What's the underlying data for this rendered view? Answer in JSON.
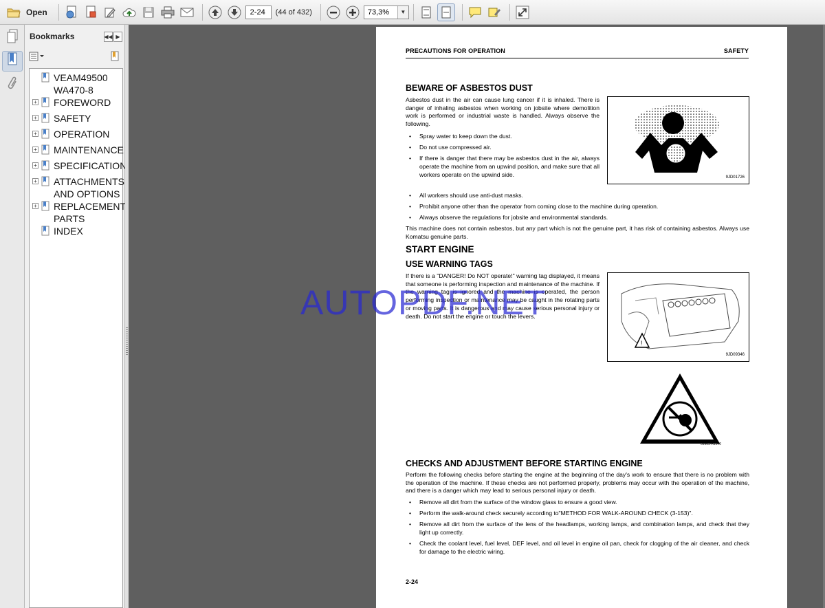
{
  "toolbar": {
    "open_label": "Open",
    "page_input": "2-24",
    "page_count": "(44 of 432)",
    "zoom_value": "73,3%"
  },
  "bookmarks": {
    "title": "Bookmarks",
    "items": [
      {
        "label": "VEAM49500 WA470-8",
        "expandable": false
      },
      {
        "label": "FOREWORD",
        "expandable": true
      },
      {
        "label": "SAFETY",
        "expandable": true
      },
      {
        "label": "OPERATION",
        "expandable": true
      },
      {
        "label": "MAINTENANCE",
        "expandable": true
      },
      {
        "label": "SPECIFICATIONS",
        "expandable": true
      },
      {
        "label": "ATTACHMENTS AND OPTIONS",
        "expandable": true
      },
      {
        "label": "REPLACEMENT PARTS",
        "expandable": true
      },
      {
        "label": "INDEX",
        "expandable": false
      }
    ]
  },
  "page": {
    "header_left": "PRECAUTIONS FOR OPERATION",
    "header_right": "SAFETY",
    "asbestos": {
      "title": "BEWARE OF ASBESTOS DUST",
      "intro": "Asbestos dust in the air can cause lung cancer if it is inhaled. There is danger of inhaling asbestos when working on jobsite where demolition work is performed or industrial waste is handled. Always observe the following.",
      "bullets": [
        "Spray water to keep down the dust.",
        "Do not use compressed air.",
        "If there is danger that there may be asbestos dust in the air, always operate the machine from an upwind position, and make sure that all workers operate on the upwind side."
      ],
      "bullets_wide": [
        "All workers should use anti-dust masks.",
        "Prohibit anyone other than the operator from coming close to the machine during operation.",
        "Always observe the regulations for jobsite and environmental standards."
      ],
      "closing": "This machine does not contain asbestos, but any part which is not the genuine part, it has risk of containing asbestos. Always use Komatsu genuine parts.",
      "fig_code": "9JD01726"
    },
    "start_engine": {
      "title": "START ENGINE",
      "subtitle": "USE WARNING TAGS",
      "text": "If there is a \"DANGER! Do NOT operate!\" warning tag displayed, it means that someone is performing inspection and maintenance of the machine. If the warning tag is ignored and the machine is operated, the person performing inspection or maintenance may be caught in the rotating parts or moving parts. It is dangerous and may cause serious personal injury or death. Do not start the engine or touch the levers.",
      "fig_code": "9JD09346",
      "sign_code": "09963-A1640"
    },
    "checks": {
      "title": "CHECKS AND ADJUSTMENT BEFORE STARTING ENGINE",
      "intro": "Perform the following checks before starting the engine at the beginning of the day's work to ensure that there is no problem with the operation of the machine. If these checks are not performed properly, problems may occur with the operation of the machine, and there is a danger which may lead to serious personal injury or death.",
      "bullets": [
        "Remove all dirt from the surface of the window glass to ensure a good view.",
        "Perform the walk-around check securely according to\"METHOD FOR WALK-AROUND CHECK (3-153)\".",
        "Remove all dirt from the surface of the lens of the headlamps, working lamps, and combination lamps, and check that they light up correctly.",
        "Check the coolant level, fuel level, DEF level, and oil level in engine oil pan, check for clogging of the air cleaner, and check for damage to the electric wiring."
      ]
    },
    "page_number": "2-24"
  },
  "watermark": "AUTOPDF.NET"
}
